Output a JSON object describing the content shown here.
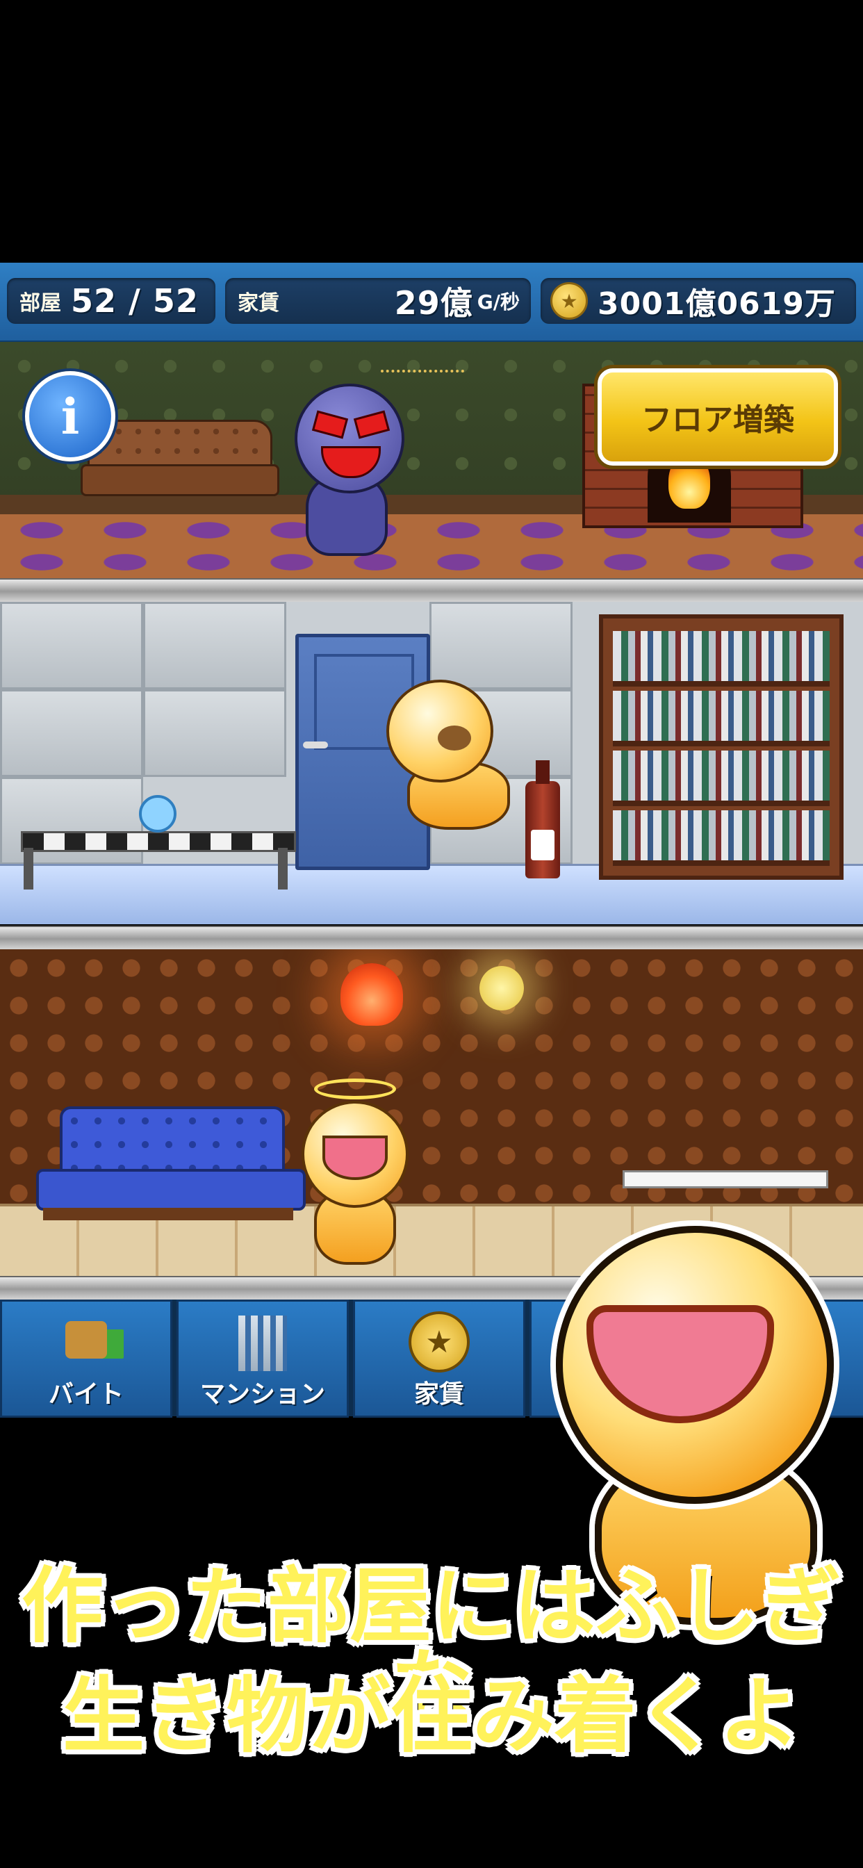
{
  "status": {
    "rooms_label": "部屋",
    "rooms_value": "52 / 52",
    "rent_label": "家賃",
    "rent_value": "29億",
    "rent_unit": "G/秒",
    "money_value": "3001億0619万"
  },
  "buttons": {
    "info": "i",
    "build_floor": "フロア増築"
  },
  "nav": {
    "items": [
      {
        "label": "バイト",
        "icon": "part-time-job-icon"
      },
      {
        "label": "マンション",
        "icon": "mansion-building-icon"
      },
      {
        "label": "家賃",
        "icon": "gold-coin-icon"
      }
    ]
  },
  "caption": {
    "line1": "作った部屋にはふしぎな",
    "line2": "生き物が住み着くよ"
  },
  "colors": {
    "status_bar": "#2f7fc4",
    "build_button": "#f3c417",
    "caption_text": "#fff25a"
  }
}
